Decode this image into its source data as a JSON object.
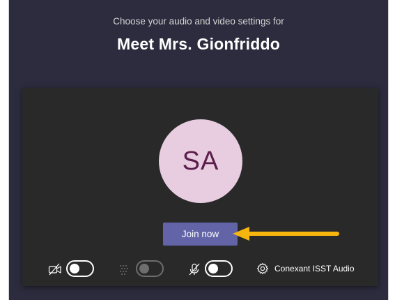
{
  "header": {
    "subtitle": "Choose your audio and video settings for",
    "meeting_title": "Meet Mrs. Gionfriddo"
  },
  "preview": {
    "avatar_initials": "SA",
    "avatar_bg": "#e8cde1",
    "avatar_fg": "#5b1e4a"
  },
  "join": {
    "label": "Join now",
    "color": "#6264a7"
  },
  "annotation": {
    "arrow_color": "#f6b60e"
  },
  "controls": {
    "camera": {
      "icon": "camera-off-icon",
      "state": "off"
    },
    "background_blur": {
      "icon": "background-blur-icon",
      "state": "off",
      "disabled": true
    },
    "microphone": {
      "icon": "mic-off-icon",
      "state": "off"
    },
    "device_settings": {
      "icon": "gear-icon",
      "label": "Conexant ISST Audio"
    }
  }
}
